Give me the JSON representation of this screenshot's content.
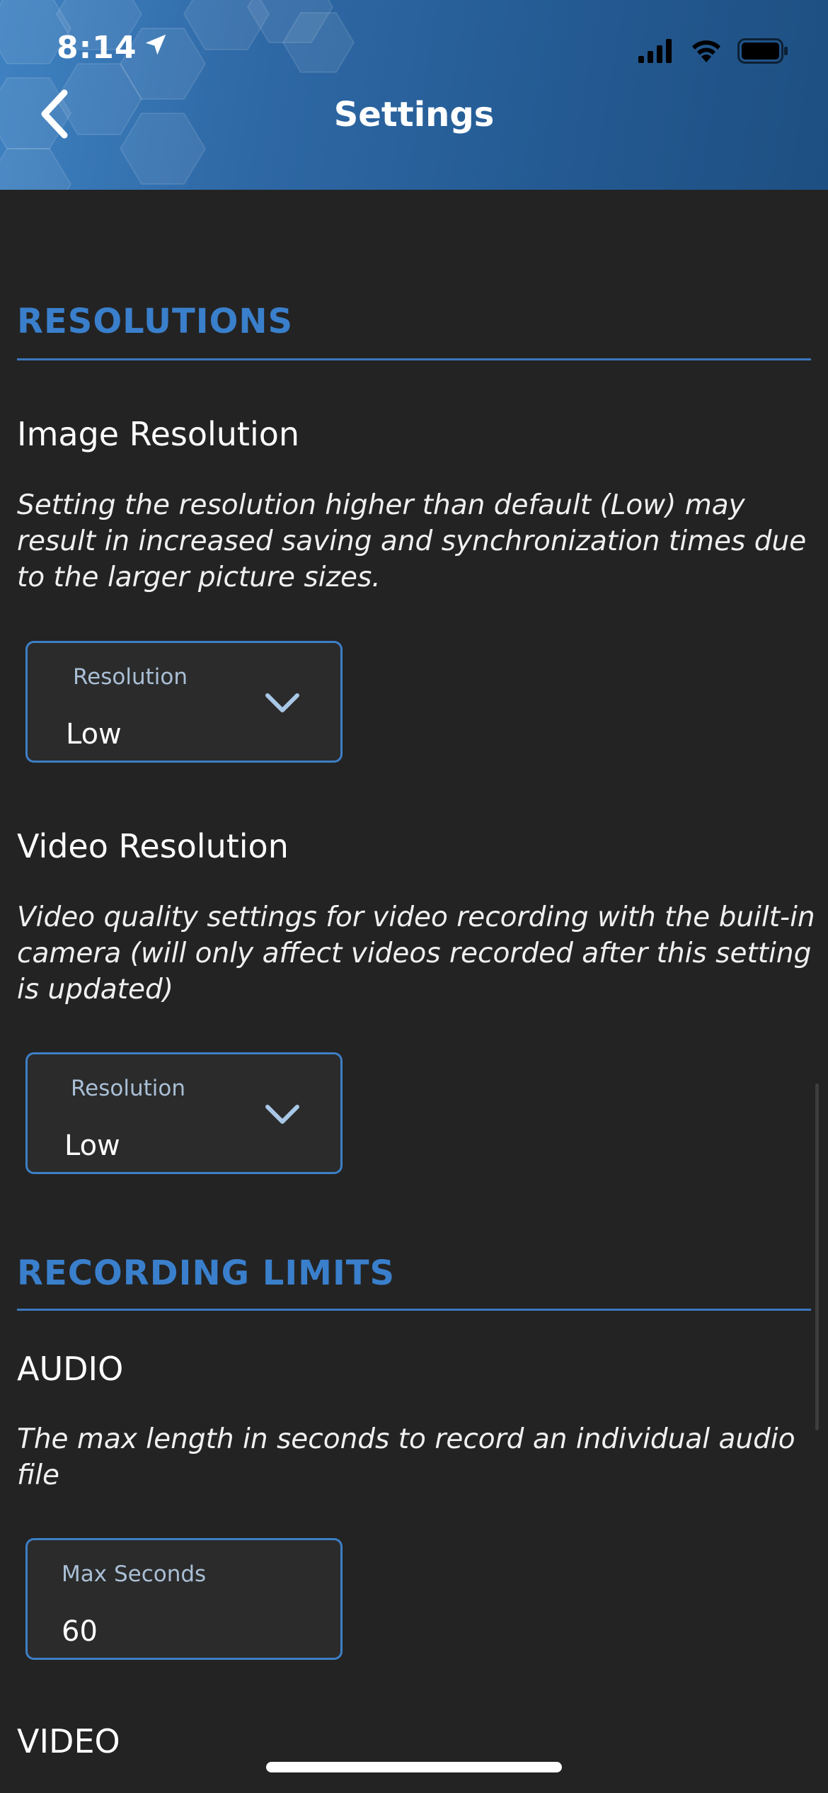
{
  "status_bar": {
    "time": "8:14",
    "icons": [
      "location-arrow-icon",
      "signal-icon",
      "wifi-icon",
      "battery-icon"
    ]
  },
  "header": {
    "title": "Settings",
    "back_icon": "chevron-left-icon"
  },
  "colors": {
    "accent": "#3a7fcb",
    "background": "#232323",
    "header_gradient_start": "#3f82c2",
    "header_gradient_end": "#1e4f82"
  },
  "sections": {
    "resolutions": {
      "title": "RESOLUTIONS",
      "image": {
        "heading": "Image Resolution",
        "description": "Setting the resolution higher than default (Low) may result in increased saving and synchronization times due to the larger picture sizes.",
        "field_label": "Resolution",
        "field_value": "Low"
      },
      "video": {
        "heading": "Video Resolution",
        "description": "Video quality settings for video recording with the built-in camera (will only affect videos recorded after this setting is updated)",
        "field_label": "Resolution",
        "field_value": "Low"
      }
    },
    "recording_limits": {
      "title": "RECORDING LIMITS",
      "audio": {
        "heading": "AUDIO",
        "description": "The max length in seconds to record an individual audio file",
        "field_label": "Max Seconds",
        "field_value": "60"
      },
      "video": {
        "heading": "VIDEO"
      }
    }
  }
}
